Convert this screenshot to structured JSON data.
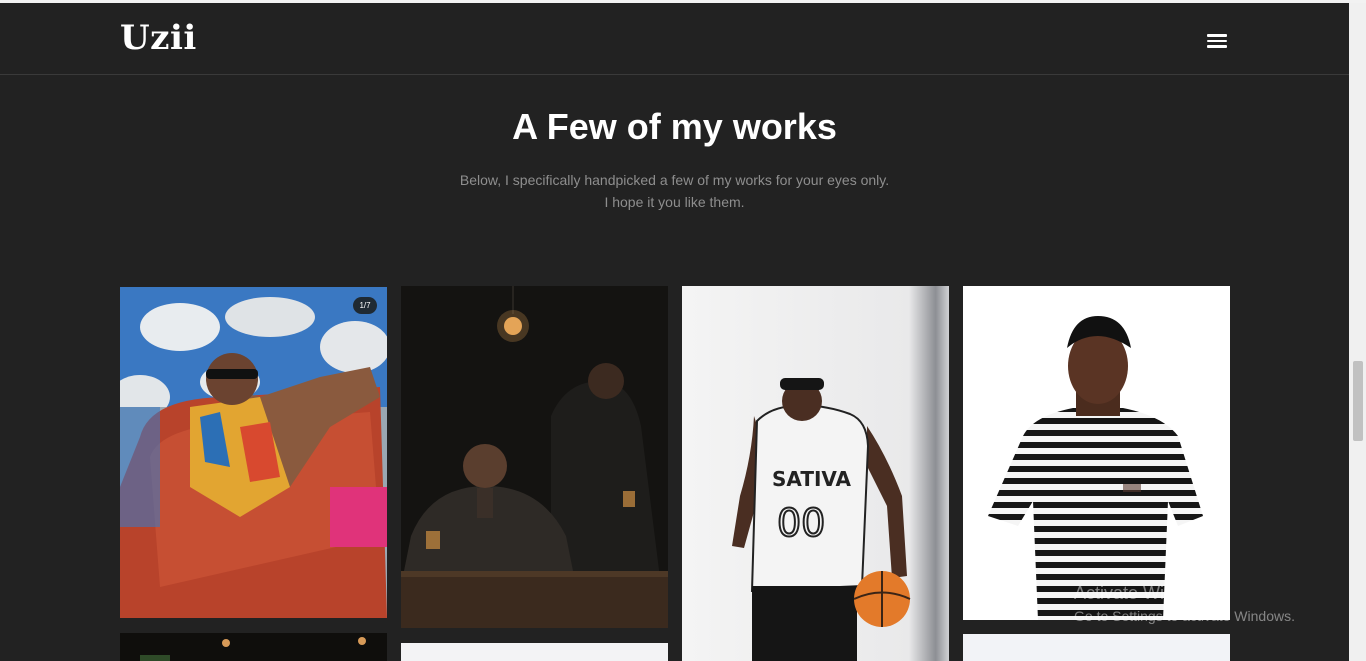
{
  "navbar": {
    "logo": "Uzii",
    "menu_icon": "hamburger-menu-icon"
  },
  "section": {
    "title": "A Few of my works",
    "subtitle_line1": "Below, I specifically handpicked a few of my works for your eyes only.",
    "subtitle_line2": "I hope it you like them."
  },
  "gallery": {
    "items": [
      {
        "badge": "1/7",
        "subject": "man in sunglasses on red armchair"
      },
      {
        "subject": "two men in dark suits"
      },
      {
        "subject": "man in Sativa 00 basketball jersey"
      },
      {
        "subject": "young man in striped t-shirt"
      }
    ]
  },
  "watermark": {
    "line1": "Activate Windows",
    "line2": "Go to Settings to activate Windows."
  }
}
